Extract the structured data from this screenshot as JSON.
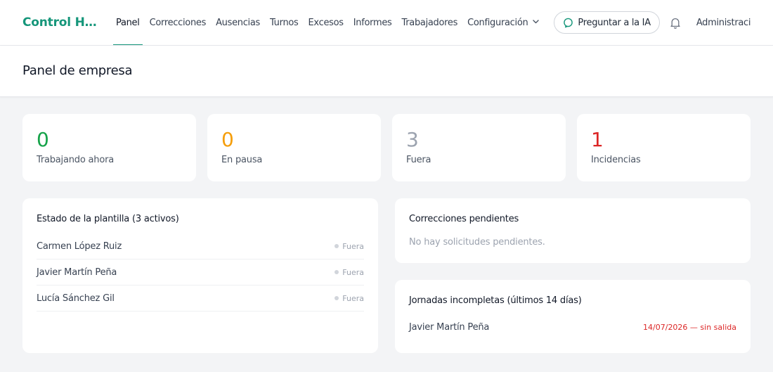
{
  "app": {
    "title": "Control Hor..."
  },
  "nav": {
    "items": [
      {
        "label": "Panel",
        "active": true
      },
      {
        "label": "Correcciones"
      },
      {
        "label": "Ausencias"
      },
      {
        "label": "Turnos"
      },
      {
        "label": "Excesos"
      },
      {
        "label": "Informes"
      },
      {
        "label": "Trabajadores"
      },
      {
        "label": "Configuración",
        "has_dropdown": true
      }
    ],
    "ask_ai_label": "Preguntar a la IA",
    "user_label": "Administraci"
  },
  "page": {
    "title": "Panel de empresa"
  },
  "stats": [
    {
      "value": "0",
      "label": "Trabajando ahora",
      "color": "#16a34a"
    },
    {
      "value": "0",
      "label": "En pausa",
      "color": "#f59e0b"
    },
    {
      "value": "3",
      "label": "Fuera",
      "color": "#9ca3af"
    },
    {
      "value": "1",
      "label": "Incidencias",
      "color": "#dc2626"
    }
  ],
  "staff": {
    "title": "Estado de la plantilla (3 activos)",
    "rows": [
      {
        "name": "Carmen López Ruiz",
        "status": "Fuera"
      },
      {
        "name": "Javier Martín Peña",
        "status": "Fuera"
      },
      {
        "name": "Lucía Sánchez Gil",
        "status": "Fuera"
      }
    ]
  },
  "corrections": {
    "title": "Correcciones pendientes",
    "empty": "No hay solicitudes pendientes."
  },
  "incomplete": {
    "title": "Jornadas incompletas (últimos 14 días)",
    "rows": [
      {
        "name": "Javier Martín Peña",
        "detail": "14/07/2026 — sin salida"
      }
    ]
  },
  "colors": {
    "brand": "#15967a",
    "danger": "#dc2626",
    "success": "#16a34a",
    "warning": "#f59e0b",
    "muted": "#9ca3af"
  },
  "icons": {
    "ask_ai": "chat-bubble-icon",
    "notifications": "bell-icon",
    "dropdown": "chevron-down-icon",
    "status": "status-dot-icon"
  }
}
